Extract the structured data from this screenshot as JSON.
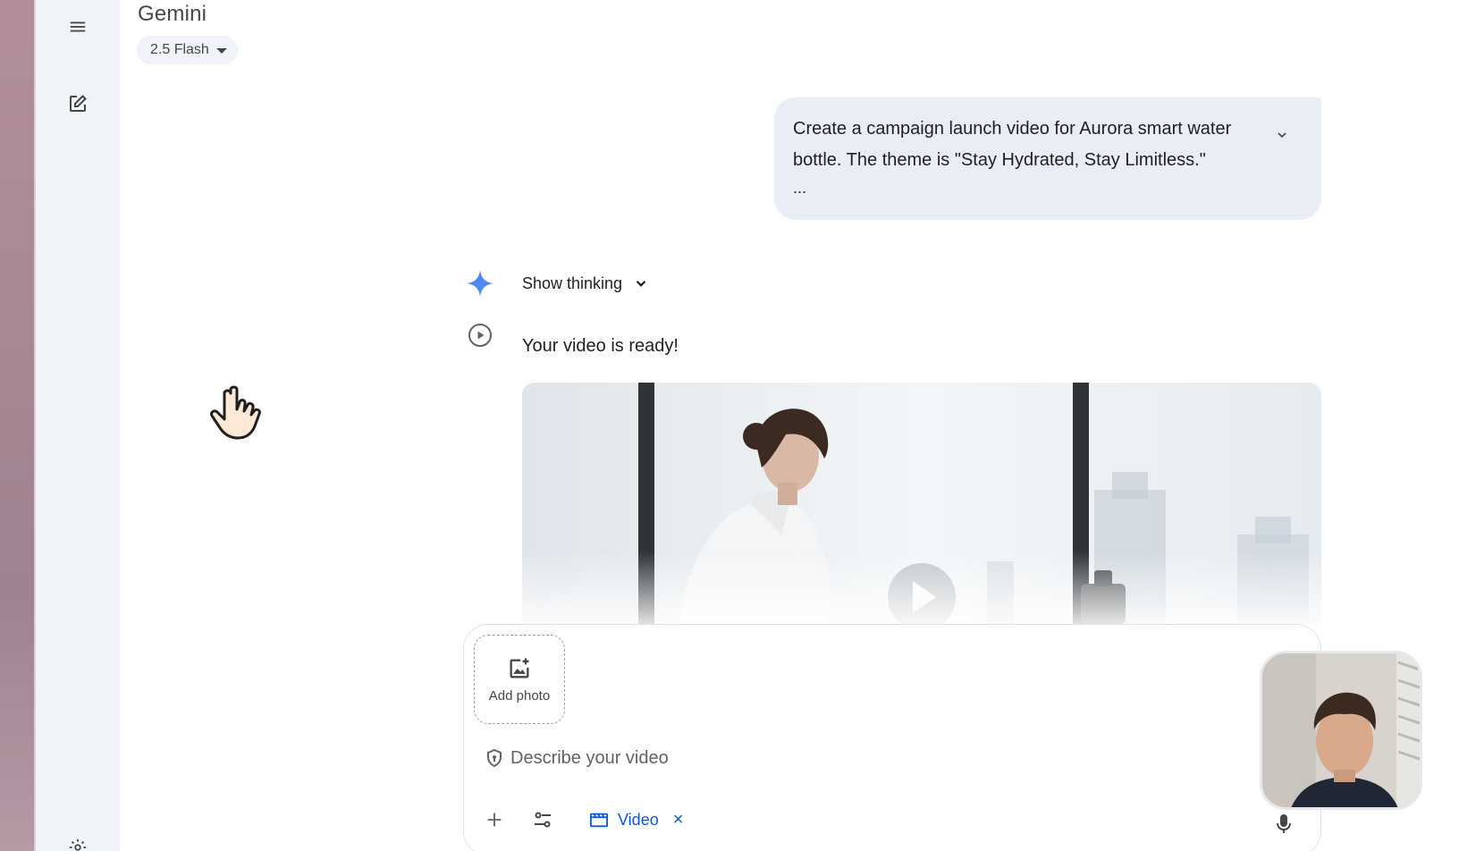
{
  "app": {
    "title": "Gemini",
    "model_label": "2.5 Flash"
  },
  "rail": {
    "icons": [
      "menu-icon",
      "edit-square-icon",
      "gear-icon"
    ]
  },
  "conversation": {
    "user_prompt_line1": "Create a campaign launch video for Aurora smart water",
    "user_prompt_line2": "bottle. The theme is \"Stay Hydrated, Stay Limitless.\"",
    "user_prompt_more": "...",
    "show_thinking_label": "Show thinking",
    "response_text": "Your video is ready!"
  },
  "composer": {
    "add_photo_label": "Add photo",
    "placeholder": "Describe your video",
    "video_chip_label": "Video",
    "chip_close": "×"
  },
  "colors": {
    "rail_bg": "#f0f4f9",
    "bubble_bg": "#e9eef6",
    "accent_blue": "#0b57d0",
    "spark_blue": "#4285f4"
  }
}
